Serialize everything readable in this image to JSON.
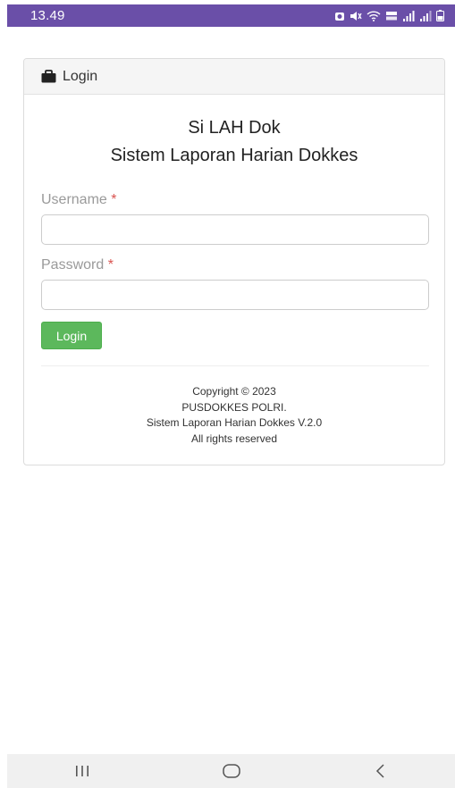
{
  "status_bar": {
    "time": "13.49",
    "icons": [
      "alarm-icon",
      "mute-icon",
      "wifi-icon",
      "volte-icon",
      "signal-icon",
      "signal-icon-2",
      "battery-icon"
    ],
    "background": "#6a4fa8"
  },
  "card": {
    "header_icon": "briefcase-icon",
    "header_title": "Login",
    "title_line1": "Si LAH Dok",
    "title_line2": "Sistem Laporan Harian Dokkes",
    "username": {
      "label": "Username",
      "required_mark": "*",
      "value": ""
    },
    "password": {
      "label": "Password",
      "required_mark": "*",
      "value": ""
    },
    "login_button": "Login",
    "login_button_color": "#5cb85c",
    "footer": {
      "line1": "Copyright © 2023",
      "line2": "PUSDOKKES POLRI.",
      "line3": "Sistem Laporan Harian Dokkes V.2.0",
      "line4": "All rights reserved"
    }
  },
  "nav_bar": {
    "buttons": [
      "recent-apps-icon",
      "home-icon",
      "back-icon"
    ]
  }
}
